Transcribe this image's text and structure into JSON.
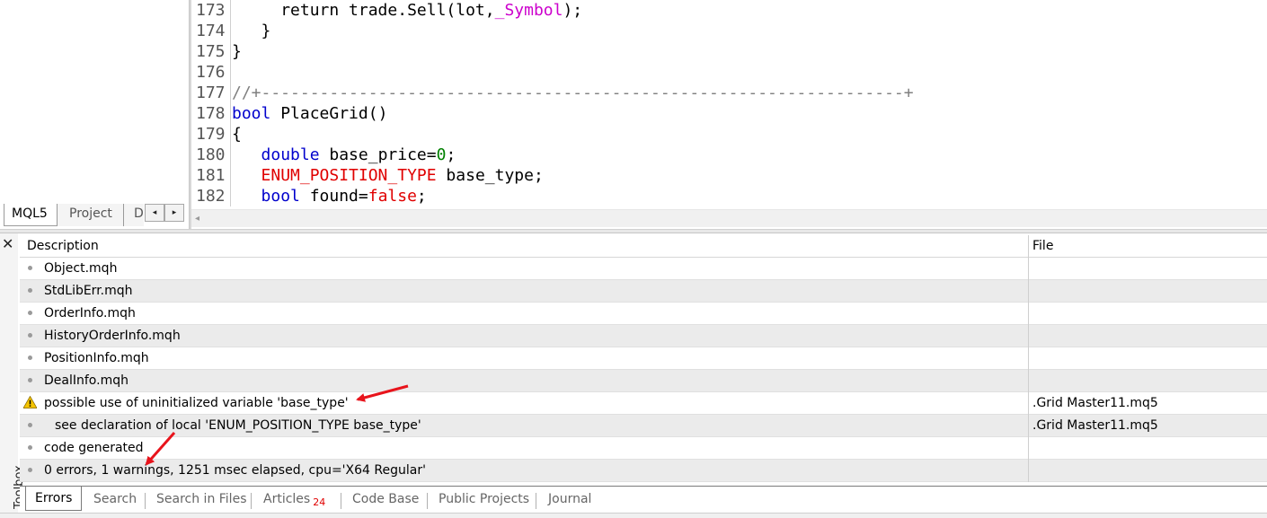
{
  "navigator": {
    "tabs": [
      {
        "label": "MQL5"
      },
      {
        "label": "Project"
      },
      {
        "label": "D"
      }
    ],
    "scroll_left_glyph": "◂",
    "scroll_right_glyph": "▸"
  },
  "editor": {
    "lines": [
      {
        "num": "173",
        "indent": "     ",
        "segments": [
          {
            "t": "return trade.Sell(lot,",
            "c": "plain"
          },
          {
            "t": "_Symbol",
            "c": "mag"
          },
          {
            "t": ");",
            "c": "plain"
          }
        ]
      },
      {
        "num": "174",
        "indent": "   ",
        "segments": [
          {
            "t": "}",
            "c": "plain"
          }
        ]
      },
      {
        "num": "175",
        "indent": "",
        "segments": [
          {
            "t": "}",
            "c": "plain"
          }
        ]
      },
      {
        "num": "176",
        "indent": "",
        "segments": []
      },
      {
        "num": "177",
        "indent": "",
        "segments": [
          {
            "t": "//+------------------------------------------------------------------+",
            "c": "cmt"
          }
        ]
      },
      {
        "num": "178",
        "indent": "",
        "segments": [
          {
            "t": "bool",
            "c": "kw"
          },
          {
            "t": " PlaceGrid()",
            "c": "plain"
          }
        ]
      },
      {
        "num": "179",
        "indent": "",
        "segments": [
          {
            "t": "{",
            "c": "plain"
          }
        ]
      },
      {
        "num": "180",
        "indent": "   ",
        "segments": [
          {
            "t": "double",
            "c": "kw"
          },
          {
            "t": " base_price=",
            "c": "plain"
          },
          {
            "t": "0",
            "c": "num"
          },
          {
            "t": ";",
            "c": "plain"
          }
        ]
      },
      {
        "num": "181",
        "indent": "   ",
        "segments": [
          {
            "t": "ENUM_POSITION_TYPE",
            "c": "kw-red"
          },
          {
            "t": " base_type;",
            "c": "plain"
          }
        ]
      },
      {
        "num": "182",
        "indent": "   ",
        "segments": [
          {
            "t": "bool",
            "c": "kw"
          },
          {
            "t": " found=",
            "c": "plain"
          },
          {
            "t": "false",
            "c": "kw-red"
          },
          {
            "t": ";",
            "c": "plain"
          }
        ]
      }
    ],
    "hscroll_glyph": "◂"
  },
  "toolbox": {
    "label": "Toolbox",
    "close_glyph": "✕",
    "columns": {
      "description": "Description",
      "file": "File"
    },
    "rows": [
      {
        "desc": "Object.mqh",
        "file": "",
        "type": "info"
      },
      {
        "desc": "StdLibErr.mqh",
        "file": "",
        "type": "info"
      },
      {
        "desc": "OrderInfo.mqh",
        "file": "",
        "type": "info"
      },
      {
        "desc": "HistoryOrderInfo.mqh",
        "file": "",
        "type": "info"
      },
      {
        "desc": "PositionInfo.mqh",
        "file": "",
        "type": "info"
      },
      {
        "desc": "DealInfo.mqh",
        "file": "",
        "type": "info"
      },
      {
        "desc": "possible use of uninitialized variable 'base_type'",
        "file": ".Grid Master11.mq5",
        "type": "warning"
      },
      {
        "desc": "see declaration of local 'ENUM_POSITION_TYPE base_type'",
        "file": ".Grid Master11.mq5",
        "type": "info-indent"
      },
      {
        "desc": "code generated",
        "file": "",
        "type": "info"
      },
      {
        "desc": "0 errors, 1 warnings, 1251 msec elapsed, cpu='X64 Regular'",
        "file": "",
        "type": "info"
      }
    ],
    "tabs": [
      {
        "label": "Errors",
        "badge": ""
      },
      {
        "label": "Search",
        "badge": ""
      },
      {
        "label": "Search in Files",
        "badge": ""
      },
      {
        "label": "Articles",
        "badge": "24"
      },
      {
        "label": "Code Base",
        "badge": ""
      },
      {
        "label": "Public Projects",
        "badge": ""
      },
      {
        "label": "Journal",
        "badge": ""
      }
    ]
  },
  "colors": {
    "keyword": "#0000cc",
    "keyword_red": "#e00000",
    "number": "#008000",
    "macro": "#cc00cc",
    "comment": "#808080",
    "annotation_arrow": "#e8141c",
    "row_shade": "#ebebeb"
  }
}
